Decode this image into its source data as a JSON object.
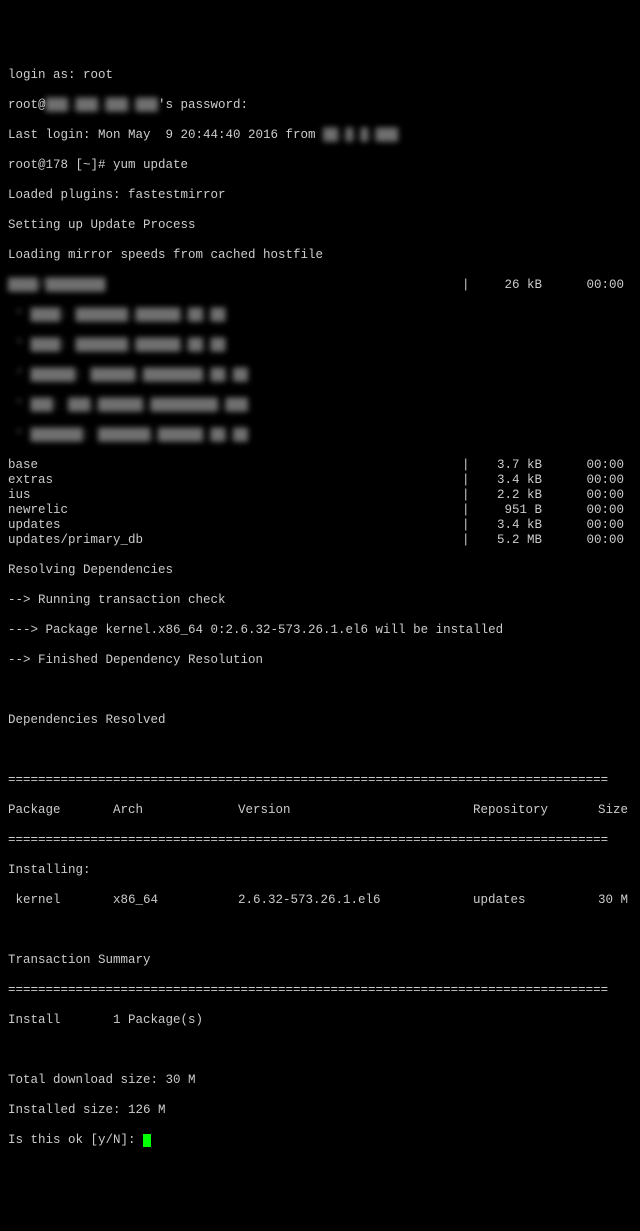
{
  "login": {
    "prompt": "login as: root",
    "pass_prefix": "root@",
    "pass_ip": "███.███.███.███",
    "pass_suffix": "'s password:",
    "last_login_prefix": "Last login: Mon May  9 20:44:40 2016 from ",
    "last_login_from": "██.█.█.███",
    "shell_prompt": "root@178 [~]# yum update"
  },
  "plugins": "Loaded plugins: fastestmirror",
  "setup": "Setting up Update Process",
  "loading": "Loading mirror speeds from cached hostfile",
  "blurred_mirrors": [
    "████/████████",
    " * ████: ███████.██████.██.██",
    " * ████: ███████.██████.██.██",
    " * ██████: ██████.████████.██.██",
    " * ███: ███.██████.█████████.███",
    " * ███████: ███████.██████.██.██"
  ],
  "first_download": {
    "size": " 26 kB",
    "time": "00:00"
  },
  "repos": [
    {
      "name": "base",
      "size": "3.7 kB",
      "time": "00:00"
    },
    {
      "name": "extras",
      "size": "3.4 kB",
      "time": "00:00"
    },
    {
      "name": "ius",
      "size": "2.2 kB",
      "time": "00:00"
    },
    {
      "name": "newrelic",
      "size": " 951 B",
      "time": "00:00"
    },
    {
      "name": "updates",
      "size": "3.4 kB",
      "time": "00:00"
    },
    {
      "name": "updates/primary_db",
      "size": "5.2 MB",
      "time": "00:00"
    }
  ],
  "deps": {
    "resolving": "Resolving Dependencies",
    "check": "--> Running transaction check",
    "pkg": "---> Package kernel.x86_64 0:2.6.32-573.26.1.el6 will be installed",
    "finished": "--> Finished Dependency Resolution",
    "resolved": "Dependencies Resolved"
  },
  "rule": "================================================================================",
  "headers": {
    "pkg": "Package",
    "arch": "Arch",
    "ver": "Version",
    "repo": "Repository",
    "size": "Size"
  },
  "install_section": "Installing:",
  "row": {
    "pkg": " kernel",
    "arch": "x86_64",
    "ver": "2.6.32-573.26.1.el6",
    "repo": "updates",
    "size": "30 M"
  },
  "txn": "Transaction Summary",
  "install_count": "Install       1 Package(s)",
  "totals": {
    "download": "Total download size: 30 M",
    "installed": "Installed size: 126 M",
    "confirm": "Is this ok [y/N]: "
  }
}
